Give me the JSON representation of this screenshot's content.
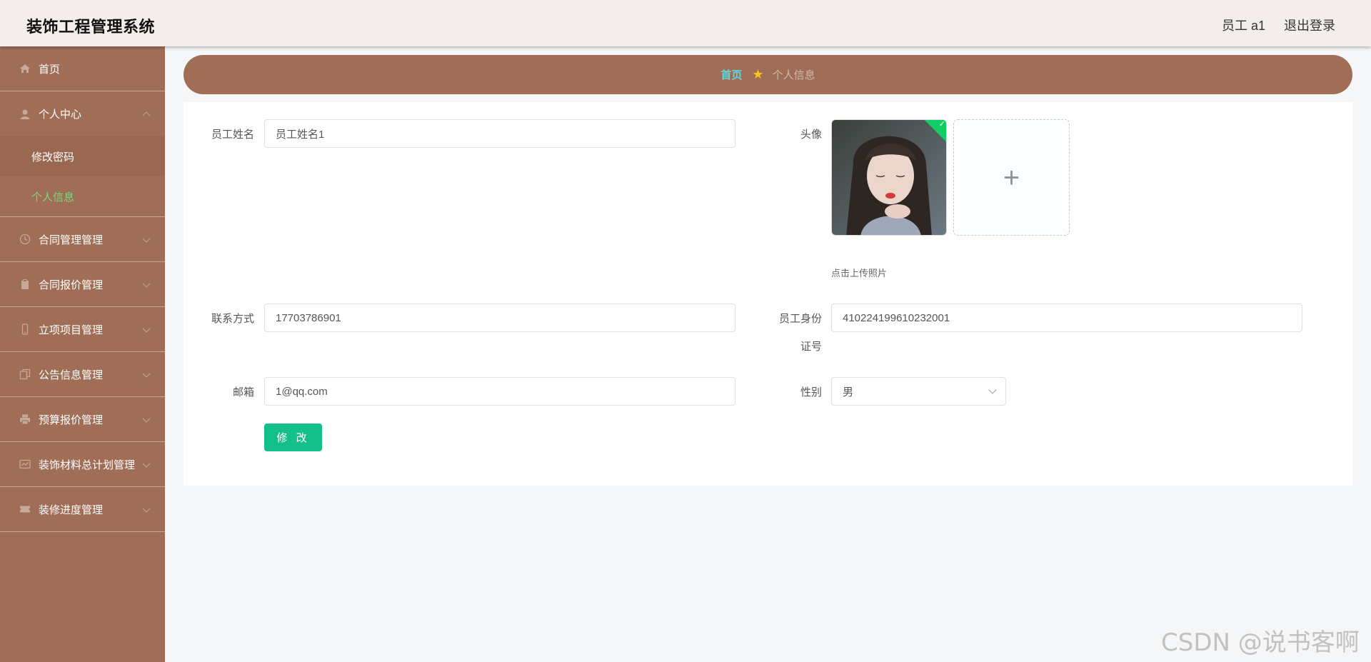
{
  "app": {
    "title": "装饰工程管理系统",
    "user": "员工 a1",
    "logout": "退出登录"
  },
  "sidebar": {
    "items": [
      {
        "label": "首页",
        "icon": "home-icon"
      },
      {
        "label": "个人中心",
        "icon": "user-icon",
        "open": true,
        "children": [
          {
            "label": "修改密码"
          },
          {
            "label": "个人信息",
            "active": true
          }
        ]
      },
      {
        "label": "合同管理管理",
        "icon": "clock-icon"
      },
      {
        "label": "合同报价管理",
        "icon": "clipboard-icon"
      },
      {
        "label": "立项项目管理",
        "icon": "phone-icon"
      },
      {
        "label": "公告信息管理",
        "icon": "copy-icon"
      },
      {
        "label": "预算报价管理",
        "icon": "printer-icon"
      },
      {
        "label": "装饰材料总计划管理",
        "icon": "chart-card-icon"
      },
      {
        "label": "装修进度管理",
        "icon": "ticket-icon"
      }
    ]
  },
  "breadcrumb": {
    "home": "首页",
    "current": "个人信息"
  },
  "form": {
    "name_label": "员工姓名",
    "name_value": "员工姓名1",
    "avatar_label": "头像",
    "upload_tip": "点击上传照片",
    "phone_label": "联系方式",
    "phone_value": "17703786901",
    "idcard_label_1": "员工身份",
    "idcard_label_2": "证号",
    "idcard_value": "410224199610232001",
    "email_label": "邮箱",
    "email_value": "1@qq.com",
    "gender_label": "性别",
    "gender_value": "男",
    "submit": "修 改"
  },
  "watermark": "CSDN @说书客啊",
  "colors": {
    "sidebar": "#a06e56",
    "accent": "#13c08a",
    "active": "#7dd87d"
  }
}
